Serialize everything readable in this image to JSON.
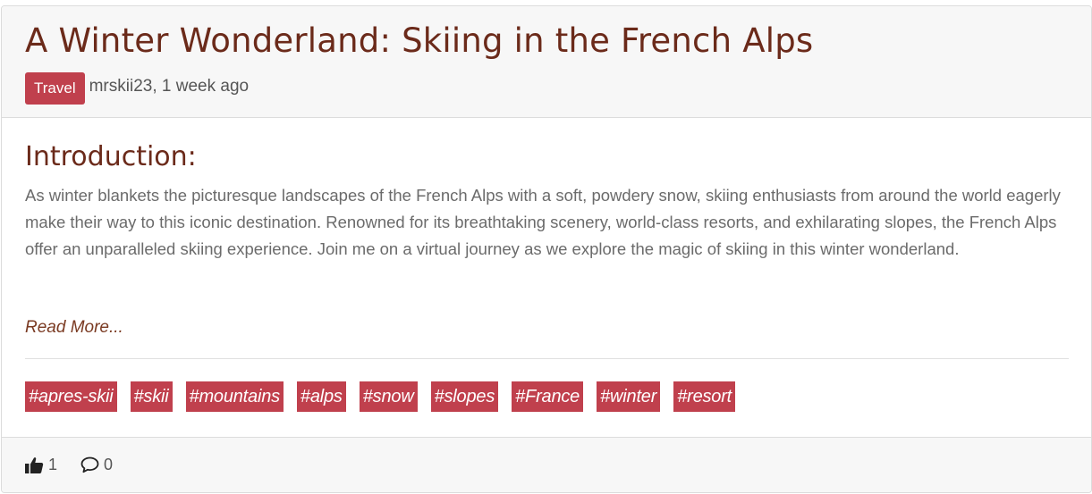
{
  "post": {
    "title": "A Winter Wonderland: Skiing in the French Alps",
    "category": "Travel",
    "author_meta": "mrskii23, 1 week ago",
    "section_heading": "Introduction:",
    "excerpt": "As winter blankets the picturesque landscapes of the French Alps with a soft, powdery snow, skiing enthusiasts from around the world eagerly make their way to this iconic destination. Renowned for its breathtaking scenery, world-class resorts, and exhilarating slopes, the French Alps offer an unparalleled skiing experience. Join me on a virtual journey as we explore the magic of skiing in this winter wonderland.",
    "read_more": "Read More...",
    "tags": [
      "#apres-skii",
      "#skii",
      "#mountains",
      "#alps",
      "#snow",
      "#slopes",
      "#France",
      "#winter",
      "#resort"
    ]
  },
  "footer": {
    "likes": "1",
    "comments": "0",
    "like_icon": "thumbs-up-icon",
    "comment_icon": "comment-icon"
  },
  "colors": {
    "accent": "#c0404d",
    "title": "#6b2a1a",
    "header_bg": "#f7f7f7"
  }
}
